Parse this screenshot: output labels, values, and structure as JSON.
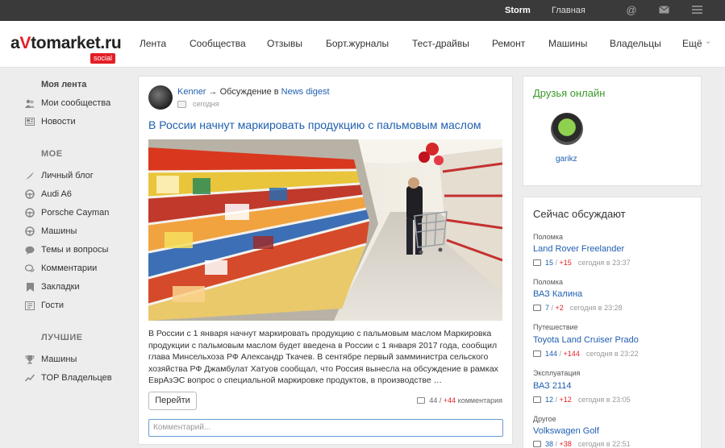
{
  "topbar": {
    "username": "Storm",
    "home": "Главная",
    "icons": [
      "at-icon",
      "mail-icon",
      "menu-icon"
    ]
  },
  "logo": {
    "text_a": "a",
    "text_v": "V",
    "text_rest": "tomarket.ru",
    "badge": "social"
  },
  "nav": [
    "Лента",
    "Сообщества",
    "Отзывы",
    "Борт.журналы",
    "Тест-драйвы",
    "Ремонт",
    "Машины",
    "Владельцы",
    "Ещё"
  ],
  "sidebar": {
    "my_feed": "Моя лента",
    "feed_items": [
      "Мои сообщества",
      "Новости"
    ],
    "mine_title": "МОЕ",
    "mine_items": [
      "Личный блог",
      "Audi A6",
      "Porsche Cayman",
      "Машины",
      "Темы и вопросы",
      "Комментарии",
      "Закладки",
      "Гости"
    ],
    "best_title": "ЛУЧШИЕ",
    "best_items": [
      "Машины",
      "TOP Владельцев"
    ]
  },
  "post": {
    "author": "Kenner",
    "arrow_text": "→ Обсуждение в",
    "group": "News digest",
    "time": "сегодня",
    "title": "В России начнут маркировать продукцию с пальмовым маслом",
    "body": "В России с 1 января начнут маркировать продукцию с пальмовым маслом Маркировка продукции с пальмовым маслом будет введена в России с 1 января 2017 года, сообщил глава Минсельхоза РФ Александр Ткачев. В сентябре первый замминистра сельского хозяйства РФ Джамбулат Хатуов сообщал, что Россия вынесла на обсуждение в рамках ЕврАзЭС вопрос о специальной маркировке продуктов, в производстве …",
    "button": "Перейти",
    "comments_count": "44",
    "comments_new": "+44",
    "comments_label": "комментария",
    "comment_placeholder": "Комментарий..."
  },
  "friends": {
    "title": "Друзья онлайн",
    "name": "garikz"
  },
  "discuss": {
    "title": "Сейчас обсуждают",
    "items": [
      {
        "category": "Поломка",
        "name": "Land Rover Freelander",
        "count": "15",
        "new": "+15",
        "time": "сегодня в 23:37"
      },
      {
        "category": "Поломка",
        "name": "ВАЗ Калина",
        "count": "7",
        "new": "+2",
        "time": "сегодня в 23:28"
      },
      {
        "category": "Путешествие",
        "name": "Toyota Land Cruiser Prado",
        "count": "144",
        "new": "+144",
        "time": "сегодня в 23:22"
      },
      {
        "category": "Эксплуатация",
        "name": "ВАЗ 2114",
        "count": "12",
        "new": "+12",
        "time": "сегодня в 23:05"
      },
      {
        "category": "Другое",
        "name": "Volkswagen Golf",
        "count": "38",
        "new": "+38",
        "time": "сегодня в 22:51"
      }
    ]
  }
}
